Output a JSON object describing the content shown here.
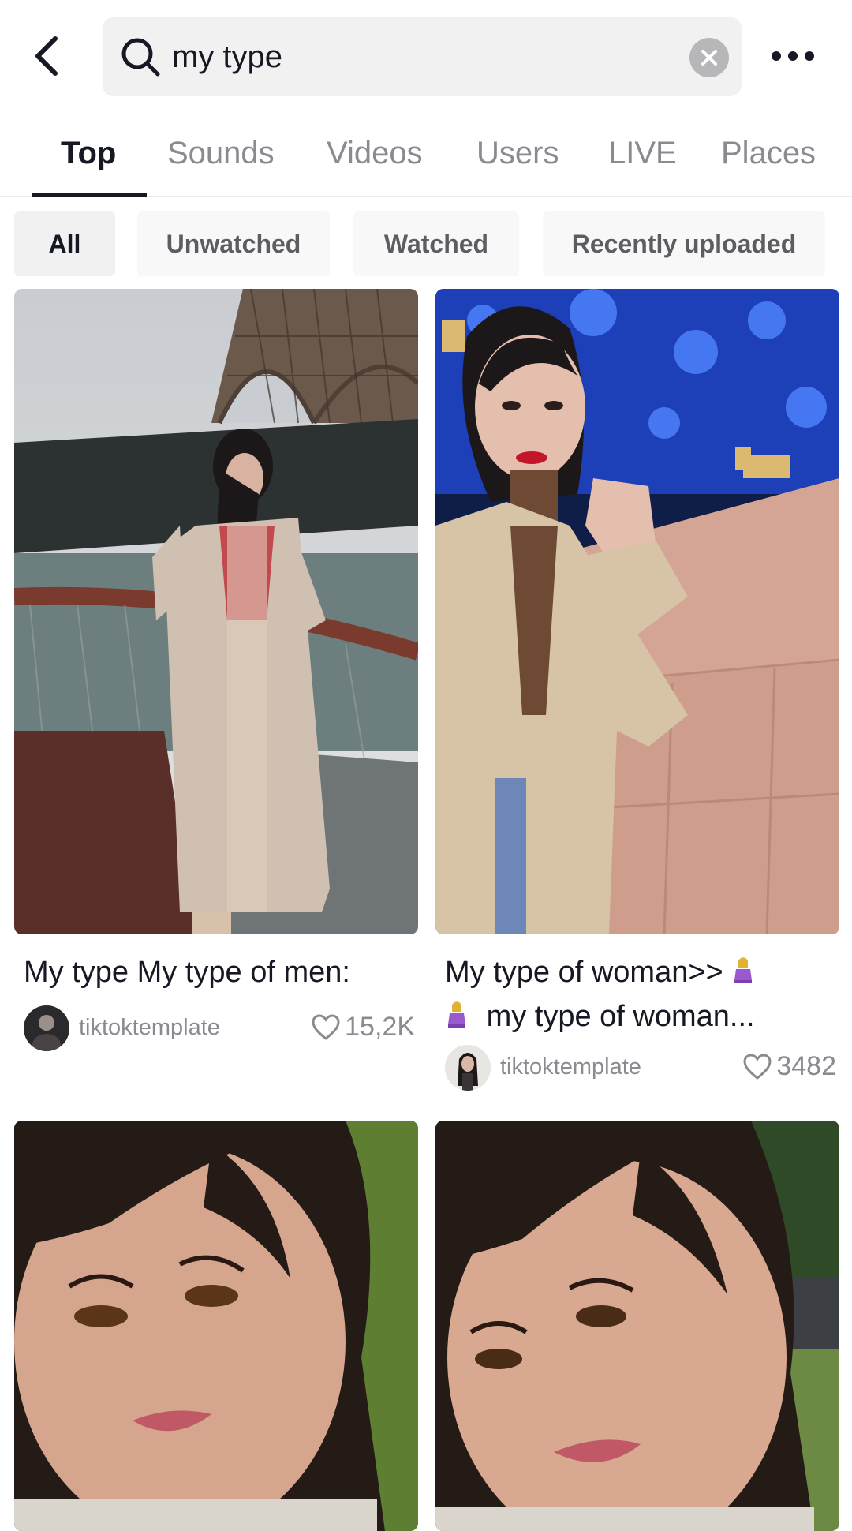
{
  "search": {
    "query": "my type",
    "back_icon": "chevron-left-icon",
    "search_icon": "search-icon",
    "clear_icon": "clear-icon",
    "more_icon": "more-horizontal-icon"
  },
  "tabs": [
    {
      "label": "Top",
      "active": true
    },
    {
      "label": "Sounds"
    },
    {
      "label": "Videos"
    },
    {
      "label": "Users"
    },
    {
      "label": "LIVE"
    },
    {
      "label": "Places"
    }
  ],
  "filters": [
    {
      "label": "All",
      "active": true
    },
    {
      "label": "Unwatched"
    },
    {
      "label": "Watched"
    },
    {
      "label": "Recently uploaded"
    }
  ],
  "results": [
    {
      "title": "My type My type of men:",
      "author": "tiktoktemplate",
      "likes": "15,2K"
    },
    {
      "title_line1": "My type of woman>>",
      "title_line2": "my type of woman...",
      "author": "tiktoktemplate",
      "likes": "3482"
    },
    {
      "title": ""
    },
    {
      "title": ""
    }
  ],
  "colors": {
    "text_primary": "#161823",
    "text_secondary": "#8a8b91",
    "search_bg": "#f1f1f2",
    "chip_bg": "#f8f8f8"
  }
}
